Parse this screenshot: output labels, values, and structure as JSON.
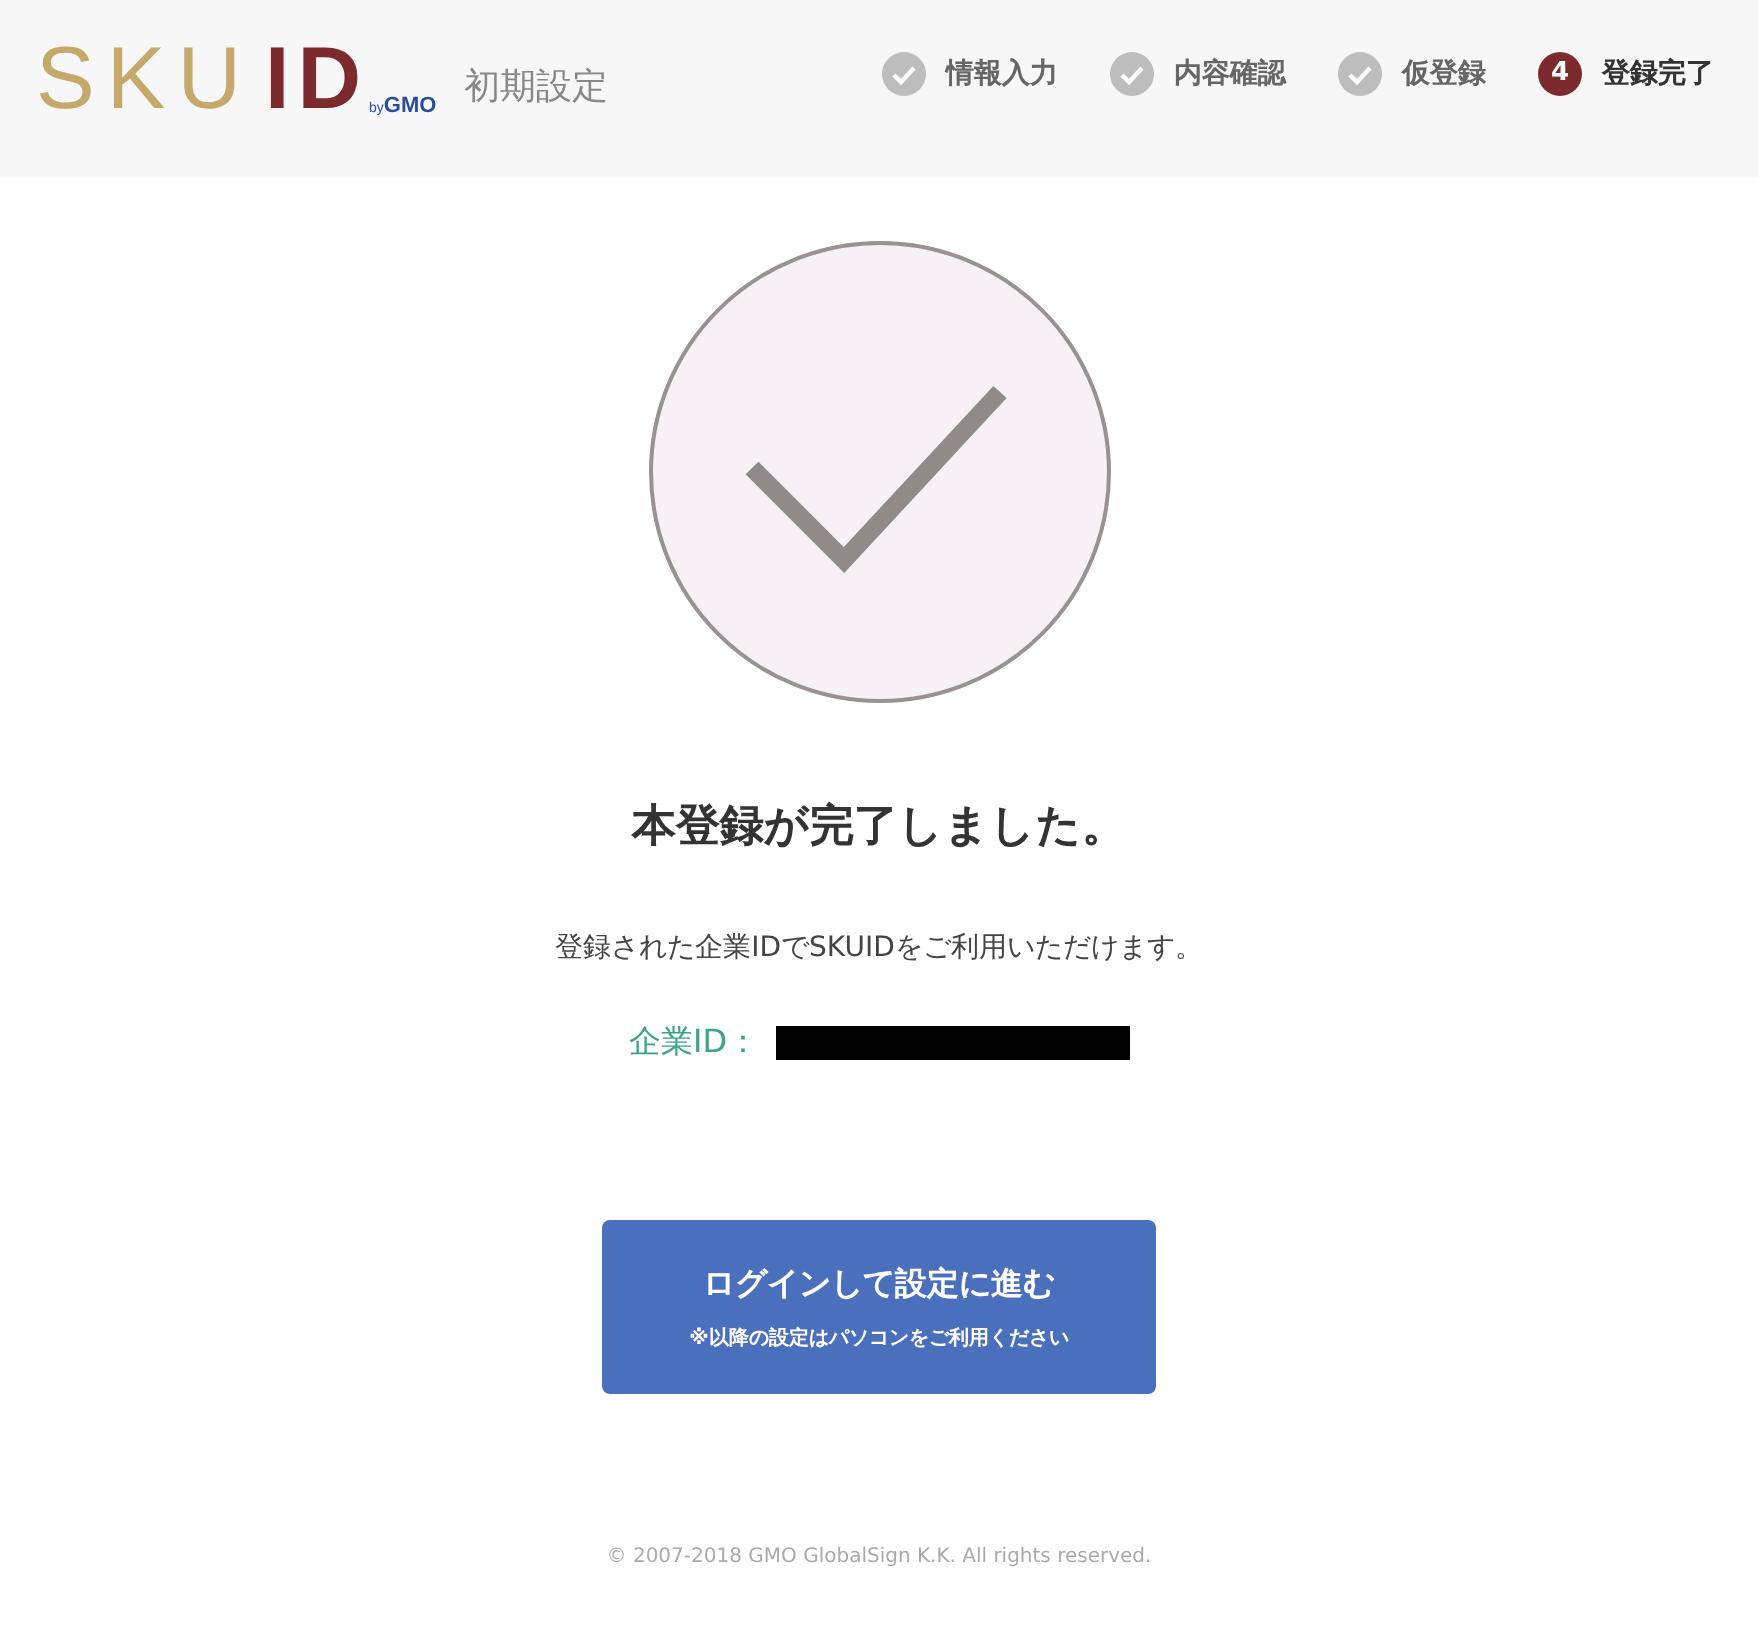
{
  "header": {
    "logo": {
      "primary": "SKU",
      "accent": "ID",
      "by": "by",
      "brand": "GMO"
    },
    "title": "初期設定",
    "steps": [
      {
        "label": "情報入力",
        "kind": "done"
      },
      {
        "label": "内容確認",
        "kind": "done"
      },
      {
        "label": "仮登録",
        "kind": "done"
      },
      {
        "label": "登録完了",
        "kind": "current",
        "marker": "4"
      }
    ]
  },
  "main": {
    "heading": "本登録が完了しました。",
    "message": "登録された企業IDでSKUIDをご利用いただけます。",
    "id_label": "企業ID：",
    "id_redacted": true,
    "button": {
      "label": "ログインして設定に進む",
      "note": "※以降の設定はパソコンをご利用ください"
    }
  },
  "footer": "© 2007-2018 GMO GlobalSign K.K. All rights reserved."
}
